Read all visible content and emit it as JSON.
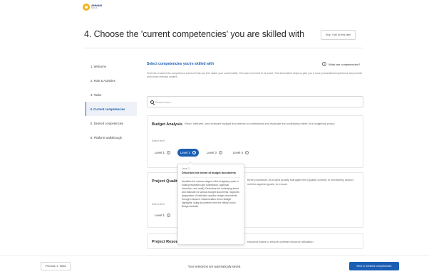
{
  "brand": {
    "logo_text": "ANNAM",
    "logo_sub": "SKILLS"
  },
  "header": {
    "title": "4. Choose the 'current competencies' you are skilled with",
    "skip_label": "Skip, I will do this later"
  },
  "sidebar": {
    "items": [
      {
        "label": "1. Welcome",
        "active": false
      },
      {
        "label": "2. Role & Activities",
        "active": false
      },
      {
        "label": "3. Tasks",
        "active": false
      },
      {
        "label": "4. Current competencies",
        "active": true
      },
      {
        "label": "5. Desired competencies",
        "active": false
      },
      {
        "label": "6. Platform walkthrough",
        "active": false
      }
    ]
  },
  "main": {
    "heading": "Select competencies you're skilled with",
    "what_link": "What are competencies?",
    "help_text": "Feel free to select the competence and level that you feel match your current skills. This does not need to be exact. This information helps us give you a more personalised experience and provide even more relevant content.",
    "search": {
      "placeholder": "Search here",
      "value": ""
    }
  },
  "competencies": [
    {
      "title": "Budget Analysis",
      "description": "Read, interpret, and evaluate budget documents to understand and evaluate the underlying intent of a budgetary policy.",
      "select_label": "Select level",
      "levels": [
        "Level 1",
        "Level 2",
        "Level 3",
        "Level 4"
      ],
      "selected": "Level 2"
    },
    {
      "title": "Project Quality Management",
      "title_visible": "Project Qualit",
      "description_visible": "three processes of project quality management (quality control) in monitoring project metrics against goals, to ensure",
      "select_label": "Select level",
      "levels": [
        "Level 1"
      ]
    },
    {
      "title_visible": "Project Resou",
      "description_visible": "resource plans to ensure optimal resource utilisation."
    }
  ],
  "tooltip": {
    "level": "Level 2",
    "heading": "Describes the intent of budget documents",
    "body": "Identifies the various stages of the budgetary cycle in India (preparation and submission, approval, execution, and audit). Describes the underlying intent and rationale for various budget documents. Supports preparation of institution-specific budget documents through research. Disseminates Union Budget highlights, using documents from the official Union Budget website."
  },
  "footer": {
    "prev_label": "Previous: 3. Tasks",
    "autosave_text": "Your selections are automatically saved.",
    "next_label": "Next: 5. Desired competencies"
  },
  "colors": {
    "accent": "#1b5fb5",
    "brand_gold": "#f2b31f"
  }
}
